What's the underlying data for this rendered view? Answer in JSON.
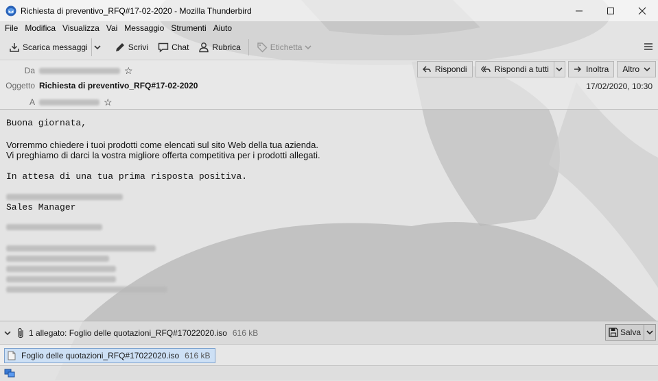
{
  "window": {
    "title": "Richiesta di preventivo_RFQ#17-02-2020 - Mozilla Thunderbird",
    "minimize_icon": "minimize-icon",
    "maximize_icon": "maximize-icon",
    "close_icon": "close-icon"
  },
  "menu": [
    "File",
    "Modifica",
    "Visualizza",
    "Vai",
    "Messaggio",
    "Strumenti",
    "Aiuto"
  ],
  "toolbar": {
    "get_messages": "Scarica messaggi",
    "write": "Scrivi",
    "chat": "Chat",
    "address_book": "Rubrica",
    "tag": "Etichetta"
  },
  "header": {
    "from_label": "Da",
    "subject_label": "Oggetto",
    "subject": "Richiesta di preventivo_RFQ#17-02-2020",
    "to_label": "A",
    "date": "17/02/2020, 10:30",
    "reply": "Rispondi",
    "reply_all": "Rispondi a tutti",
    "forward": "Inoltra",
    "more": "Altro"
  },
  "body": {
    "greeting": "Buona giornata,",
    "para1_line1": "Vorremmo chiedere i tuoi prodotti come elencati sul sito Web della tua azienda.",
    "para1_line2": "Vi preghiamo di darci la vostra migliore offerta competitiva per i prodotti allegati.",
    "closing": "In attesa di una tua prima risposta positiva.",
    "signature_title": "Sales Manager"
  },
  "attachments": {
    "summary": "1 allegato: Foglio delle quotazioni_RFQ#17022020.iso",
    "summary_size": "616 kB",
    "save": "Salva",
    "items": [
      {
        "name": "Foglio delle quotazioni_RFQ#17022020.iso",
        "size": "616 kB"
      }
    ]
  },
  "colors": {
    "selection_bg": "#cde0f5",
    "selection_border": "#7da2ce",
    "background": "#e6e6e6"
  }
}
